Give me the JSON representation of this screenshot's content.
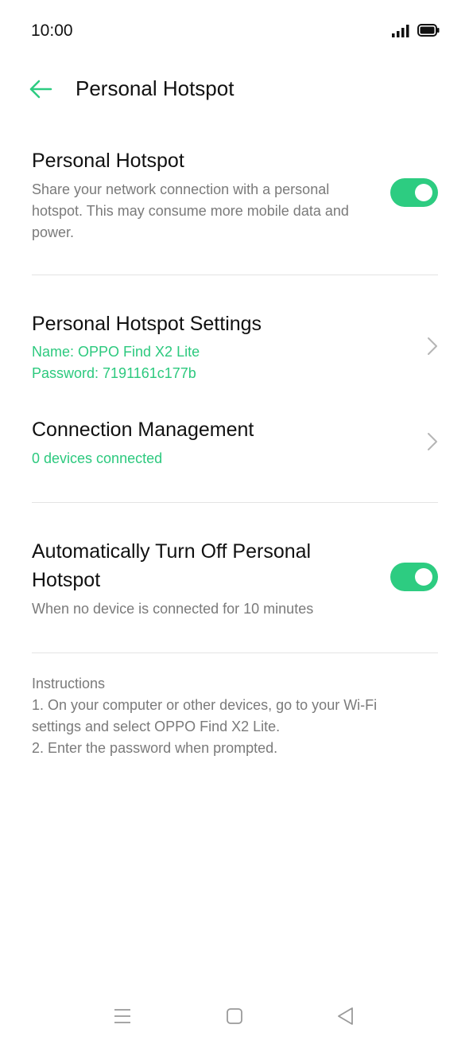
{
  "status_bar": {
    "time": "10:00"
  },
  "header": {
    "title": "Personal Hotspot"
  },
  "hotspot": {
    "title": "Personal Hotspot",
    "description": "Share your network connection with a personal hotspot. This may consume more mobile data and power.",
    "enabled": true
  },
  "hotspot_settings": {
    "title": "Personal Hotspot Settings",
    "name_line": "Name: OPPO Find X2 Lite",
    "password_line": "Password: 7191161c177b"
  },
  "connection_management": {
    "title": "Connection Management",
    "status": "0 devices connected"
  },
  "auto_off": {
    "title_line1": "Automatically Turn Off Personal",
    "title_line2": "Hotspot",
    "description": "When no device is connected for 10 minutes",
    "enabled": true
  },
  "instructions": {
    "heading": "Instructions",
    "step1": "1. On your computer or other devices, go to your Wi-Fi settings and select OPPO Find X2 Lite.",
    "step2": "2. Enter the password when prompted."
  },
  "icons": {
    "back": "back-arrow-icon",
    "chevron": "chevron-right-icon",
    "signal": "signal-icon",
    "battery": "battery-icon",
    "nav_menu": "menu-icon",
    "nav_home": "home-icon",
    "nav_back": "back-triangle-icon"
  },
  "colors": {
    "accent": "#2dcc81",
    "secondary_text": "#7a7a7a",
    "divider": "#e3e3e3"
  }
}
